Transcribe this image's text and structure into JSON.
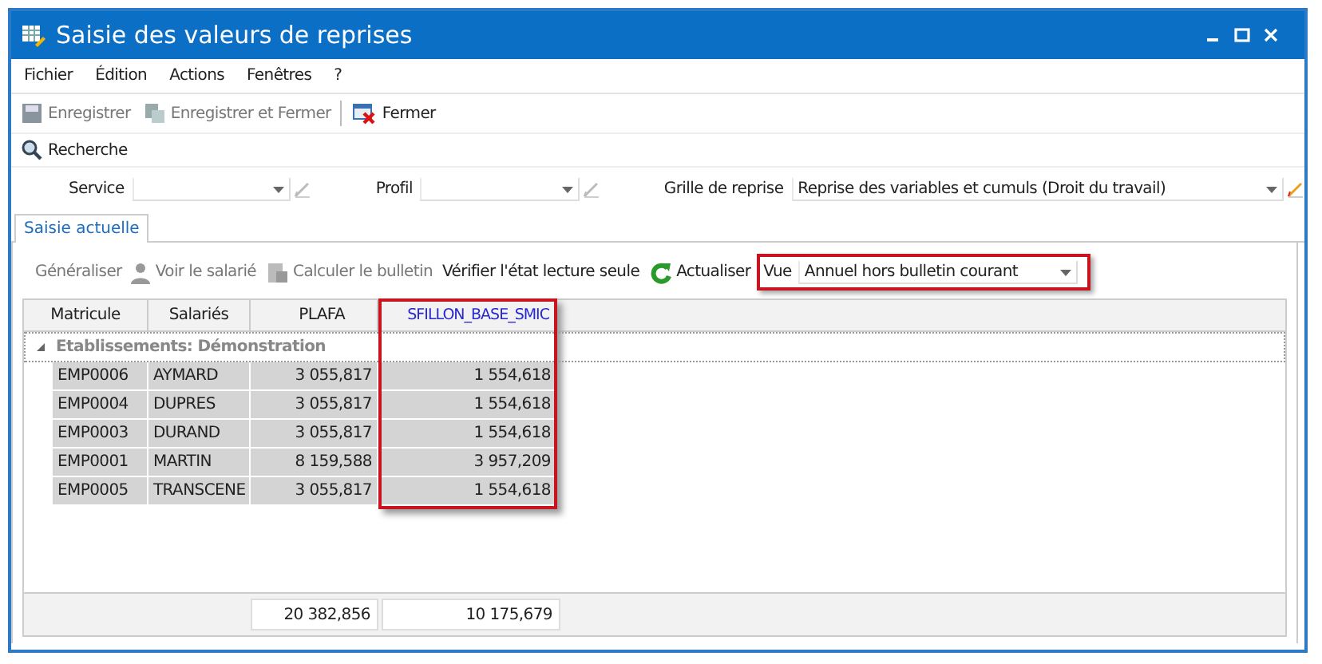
{
  "window": {
    "title": "Saisie des valeurs de reprises"
  },
  "menu": [
    "Fichier",
    "Édition",
    "Actions",
    "Fenêtres",
    "?"
  ],
  "toolbar": [
    {
      "label": "Enregistrer",
      "kind": "save",
      "disabled": true
    },
    {
      "label": "Enregistrer et Fermer",
      "kind": "savefermer",
      "disabled": true
    },
    {
      "label": "Fermer",
      "kind": "fermer",
      "disabled": false
    }
  ],
  "search_button": "Recherche",
  "filters": [
    {
      "label": "Service"
    },
    {
      "label": "Profil"
    },
    {
      "label": "Grille de reprise",
      "value": "Reprise des variables et cumuls (Droit du travail)"
    }
  ],
  "tabs": [
    {
      "label": "Saisie actuelle",
      "selected": true
    }
  ],
  "grid_toolbar": [
    {
      "label": "Généraliser",
      "kind": "text",
      "disabled": true
    },
    {
      "label": "Voir le salarié",
      "kind": "person",
      "disabled": true
    },
    {
      "label": "Calculer le bulletin",
      "kind": "calc",
      "disabled": true
    },
    {
      "label": "Vérifier l'état lecture seule",
      "kind": "text",
      "disabled": false
    },
    {
      "label": "Actualiser",
      "kind": "refresh",
      "disabled": false
    }
  ],
  "view": {
    "label": "Vue",
    "value": "Annuel hors bulletin courant",
    "highlighted": true
  },
  "table": {
    "columns": [
      {
        "label": "Matricule",
        "kind": "text",
        "highlighted": false
      },
      {
        "label": "Salariés",
        "kind": "text",
        "highlighted": false
      },
      {
        "label": "PLAFA",
        "kind": "number",
        "highlighted": false
      },
      {
        "label": "SFILLON_BASE_SMIC",
        "kind": "number",
        "highlighted": true
      }
    ],
    "group": {
      "label": "Etablissements: Démonstration",
      "expanded": true
    },
    "rows": [
      [
        "EMP0006",
        "AYMARD",
        "3 055,817",
        "1 554,618"
      ],
      [
        "EMP0004",
        "DUPRES",
        "3 055,817",
        "1 554,618"
      ],
      [
        "EMP0003",
        "DURAND",
        "3 055,817",
        "1 554,618"
      ],
      [
        "EMP0001",
        "MARTIN",
        "8 159,588",
        "3 957,209"
      ],
      [
        "EMP0005",
        "TRANSCENE",
        "3 055,817",
        "1 554,618"
      ]
    ],
    "totals": [
      "20 382,856",
      "10 175,679"
    ]
  }
}
